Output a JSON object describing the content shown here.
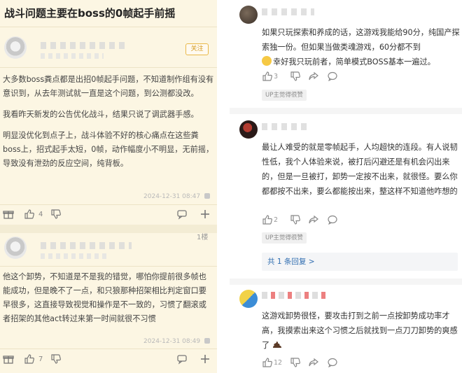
{
  "left": {
    "title": "战斗问题主要在boss的0帧起手前摇",
    "follow_label": "关注",
    "post": {
      "paragraphs": [
        "大多数boss粪点都是出招0帧起手问题，不知道制作组有没有意识到，从去年测试就一直是这个问题，到公测都没改。",
        "我看昨天新发的公告优化战斗，结果只说了调武器手感。",
        "明显没优化到点子上，战斗体验不好的核心痛点在这些粪boss上，招式起手太短，0帧，动作幅度小不明显，无前摇，导致没有泄劲的反应空间，纯背板。"
      ],
      "timestamp": "2024-12-31 08:47",
      "like_count": "4"
    },
    "reply": {
      "floor": "1楼",
      "text": "他这个卸势，不知道是不是我的错觉，哪怕你提前很多帧也能成功，但是晚不了一点，和只狼那种招架相比判定窗口要早很多，这直接导致视觉和操作是不一致的，习惯了翻滚或者招架的其他act转过来第一时间就很不习惯",
      "timestamp": "2024-12-31 08:49",
      "like_count": "7"
    }
  },
  "right": {
    "comments": [
      {
        "text_a": "如果只玩探索和养成的话，这游戏我能给90分，纯国产探索独一份。但如果当做类魂游戏，60分都不到",
        "text_b": "幸好我只玩前者，简单模式BOSS基本一遍过。",
        "like_count": "3",
        "badge": "UP主觉得很赞"
      },
      {
        "text": "最让人难受的就是零帧起手，人均超快的连段。有人说韧性低，我个人体验来说，被打后闪避还是有机会闪出来的，但是一旦被打，卸势一定按不出来，就很怪。要么你都都按不出来，要么都能按出来，整这样不知道他咋想的",
        "like_count": "2",
        "badge": "UP主觉得很赞",
        "replies_link": "共 1 条回复 >"
      },
      {
        "text": "这游戏卸势很怪，要攻击打到之前一点按卸势成功率才高，我摸索出来这个习惯之后就找到一点刀刀卸势的爽感了",
        "like_count": "12"
      }
    ]
  },
  "colors": {
    "left_bg": "#fcf6e3",
    "follow_accent": "#d49a1d",
    "link_blue": "#2f6db0"
  }
}
